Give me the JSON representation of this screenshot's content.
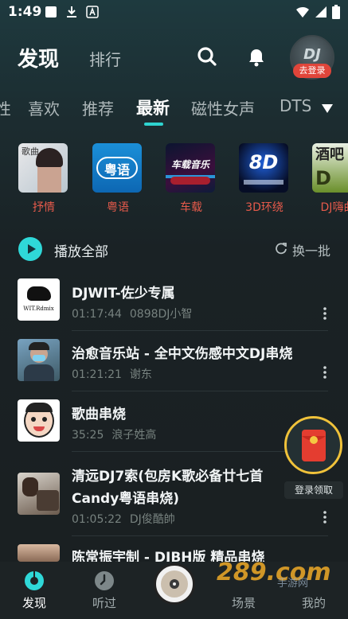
{
  "status_bar": {
    "time": "1:49"
  },
  "header": {
    "title": "发现",
    "rank": "排行",
    "avatar_text": "DJ",
    "login_badge": "去登录"
  },
  "tabs": [
    {
      "label": "性"
    },
    {
      "label": "喜欢"
    },
    {
      "label": "推荐"
    },
    {
      "label": "最新"
    },
    {
      "label": "磁性女声"
    },
    {
      "label": "DTS"
    }
  ],
  "active_tab": "最新",
  "categories": [
    {
      "label": "抒情",
      "thumb_text": "歌曲"
    },
    {
      "label": "粤语",
      "thumb_text": "粤语"
    },
    {
      "label": "车载",
      "thumb_text": "车载音乐"
    },
    {
      "label": "3D环绕",
      "thumb_text": "8D"
    },
    {
      "label": "DJ嗨曲",
      "thumb_text": "酒吧"
    }
  ],
  "play_all": {
    "label": "播放全部",
    "refresh": "换一批"
  },
  "songs": [
    {
      "title": "DJWIT-佐少专属",
      "duration": "01:17:44",
      "artist": "0898DJ小智",
      "thumb_text": "WIT.Rdmix"
    },
    {
      "title": "治愈音乐站 - 全中文伤感中文DJ串烧",
      "duration": "01:21:21",
      "artist": "谢东"
    },
    {
      "title": "歌曲串烧",
      "duration": "35:25",
      "artist": "浪子姓高"
    },
    {
      "title_line1": "清远DJ7索(包房K歌必备廿七首",
      "title_line2": "Candy粤语串烧)",
      "duration": "01:05:22",
      "artist": "DJ俊酷帥"
    },
    {
      "title": "陈常振宇制 - DJBH版 精品串烧"
    }
  ],
  "redpacket": {
    "label": "登录领取"
  },
  "bottom_nav": [
    {
      "label": "发现"
    },
    {
      "label": "听过"
    },
    {
      "label": "场景"
    },
    {
      "label": "我的"
    }
  ],
  "watermark": {
    "main": "289.com",
    "sub": "手游网"
  },
  "colors": {
    "accent": "#2ed4d0",
    "category_label": "#e55a4b",
    "badge": "#e0453a"
  }
}
